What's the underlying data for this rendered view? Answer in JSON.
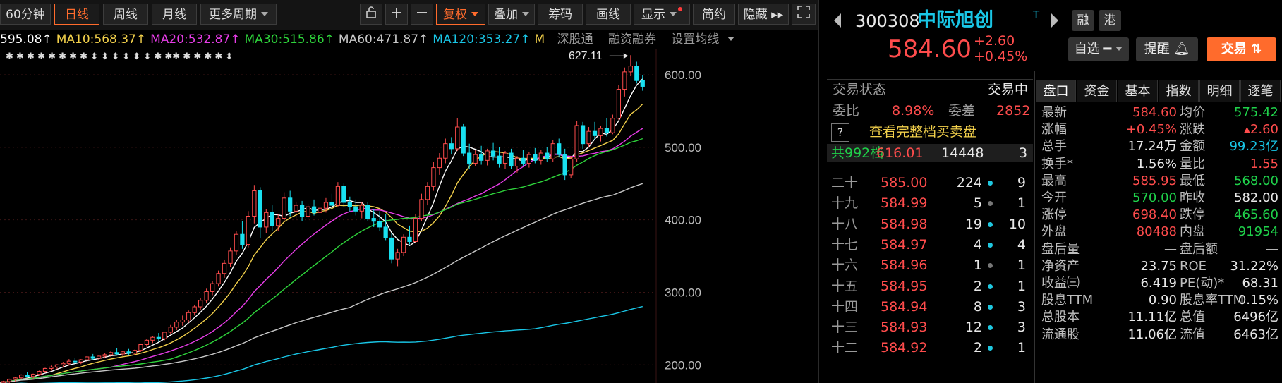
{
  "toolbar": {
    "left_buttons": [
      {
        "label": "60分钟",
        "selected": false
      },
      {
        "label": "日线",
        "selected": true
      },
      {
        "label": "周线",
        "selected": false
      },
      {
        "label": "月线",
        "selected": false
      },
      {
        "label": "更多周期",
        "selected": false,
        "dropdown": true
      }
    ],
    "right_buttons": [
      {
        "label": "复权",
        "dropdown": true,
        "active": true
      },
      {
        "label": "叠加",
        "dropdown": true
      },
      {
        "label": "筹码"
      },
      {
        "label": "画线"
      },
      {
        "label": "显示",
        "dropdown": true,
        "badge": true
      },
      {
        "label": "简约"
      },
      {
        "label": "隐藏 ▸▸"
      }
    ],
    "icons": [
      "lock-icon",
      "plus-icon",
      "minus-icon",
      "fullscreen-icon"
    ]
  },
  "ma_legend": [
    {
      "text": "595.08↑",
      "color": "#ffffff"
    },
    {
      "text": "MA10:568.37↑",
      "color": "#f2d04b"
    },
    {
      "text": "MA20:532.87↑",
      "color": "#e83de8"
    },
    {
      "text": "MA30:515.86↑",
      "color": "#2ed33b"
    },
    {
      "text": "MA60:471.87↑",
      "color": "#c8c8c8"
    },
    {
      "text": "MA120:353.27↑",
      "color": "#19c6e6"
    },
    {
      "text": "M",
      "color": "#f2d04b"
    }
  ],
  "legend_links": [
    "深股通",
    "融资融券",
    "设置均线"
  ],
  "chart_data": {
    "type": "candlestick",
    "ylim": [
      175,
      635
    ],
    "y_ticks": [
      "600.00",
      "500.00",
      "400.00",
      "300.00",
      "200.00"
    ],
    "y_tick_values": [
      600,
      500,
      400,
      300,
      200
    ],
    "annotation": {
      "label": "627.11"
    },
    "candles": [
      [
        172,
        176,
        170,
        175
      ],
      [
        175,
        178,
        172,
        177
      ],
      [
        177,
        181,
        175,
        180
      ],
      [
        180,
        183,
        177,
        182
      ],
      [
        182,
        187,
        180,
        186
      ],
      [
        186,
        190,
        183,
        184
      ],
      [
        184,
        188,
        181,
        187
      ],
      [
        187,
        192,
        185,
        191
      ],
      [
        191,
        196,
        189,
        195
      ],
      [
        195,
        199,
        192,
        197
      ],
      [
        197,
        201,
        194,
        200
      ],
      [
        200,
        204,
        197,
        202
      ],
      [
        202,
        208,
        199,
        205
      ],
      [
        205,
        209,
        201,
        204
      ],
      [
        204,
        208,
        201,
        207
      ],
      [
        207,
        212,
        204,
        211
      ],
      [
        211,
        215,
        207,
        209
      ],
      [
        209,
        213,
        206,
        212
      ],
      [
        212,
        216,
        209,
        214
      ],
      [
        214,
        219,
        211,
        217
      ],
      [
        217,
        223,
        214,
        215
      ],
      [
        215,
        219,
        212,
        218
      ],
      [
        218,
        222,
        214,
        216
      ],
      [
        216,
        221,
        213,
        220
      ],
      [
        220,
        229,
        218,
        228
      ],
      [
        228,
        236,
        225,
        234
      ],
      [
        234,
        240,
        230,
        238
      ],
      [
        238,
        244,
        232,
        236
      ],
      [
        236,
        246,
        234,
        245
      ],
      [
        245,
        255,
        242,
        252
      ],
      [
        252,
        262,
        248,
        259
      ],
      [
        259,
        268,
        254,
        262
      ],
      [
        262,
        275,
        258,
        272
      ],
      [
        272,
        283,
        268,
        280
      ],
      [
        280,
        292,
        276,
        289
      ],
      [
        289,
        305,
        285,
        301
      ],
      [
        301,
        315,
        296,
        312
      ],
      [
        312,
        330,
        308,
        326
      ],
      [
        326,
        345,
        320,
        340
      ],
      [
        340,
        362,
        335,
        357
      ],
      [
        357,
        384,
        352,
        380
      ],
      [
        380,
        398,
        360,
        366
      ],
      [
        366,
        412,
        362,
        405
      ],
      [
        405,
        448,
        395,
        440
      ],
      [
        440,
        445,
        375,
        390
      ],
      [
        390,
        415,
        382,
        410
      ],
      [
        410,
        420,
        385,
        392
      ],
      [
        392,
        408,
        385,
        402
      ],
      [
        402,
        438,
        398,
        430
      ],
      [
        430,
        440,
        405,
        412
      ],
      [
        412,
        425,
        402,
        420
      ],
      [
        420,
        426,
        398,
        405
      ],
      [
        405,
        422,
        400,
        418
      ],
      [
        418,
        428,
        406,
        410
      ],
      [
        410,
        422,
        402,
        416
      ],
      [
        416,
        430,
        410,
        424
      ],
      [
        424,
        436,
        415,
        420
      ],
      [
        420,
        452,
        418,
        446
      ],
      [
        446,
        450,
        418,
        424
      ],
      [
        424,
        432,
        412,
        418
      ],
      [
        418,
        428,
        406,
        412
      ],
      [
        412,
        424,
        402,
        420
      ],
      [
        420,
        425,
        398,
        402
      ],
      [
        402,
        415,
        390,
        398
      ],
      [
        398,
        412,
        385,
        390
      ],
      [
        390,
        408,
        372,
        375
      ],
      [
        375,
        382,
        340,
        346
      ],
      [
        346,
        360,
        336,
        355
      ],
      [
        355,
        380,
        350,
        376
      ],
      [
        376,
        392,
        366,
        370
      ],
      [
        370,
        408,
        368,
        402
      ],
      [
        402,
        436,
        398,
        428
      ],
      [
        428,
        452,
        420,
        446
      ],
      [
        446,
        480,
        440,
        472
      ],
      [
        472,
        492,
        462,
        485
      ],
      [
        485,
        512,
        478,
        505
      ],
      [
        505,
        514,
        490,
        498
      ],
      [
        498,
        540,
        495,
        528
      ],
      [
        528,
        532,
        488,
        492
      ],
      [
        492,
        505,
        470,
        478
      ],
      [
        478,
        496,
        474,
        490
      ],
      [
        490,
        502,
        476,
        482
      ],
      [
        482,
        498,
        475,
        495
      ],
      [
        495,
        506,
        482,
        488
      ],
      [
        488,
        500,
        472,
        478
      ],
      [
        478,
        495,
        470,
        492
      ],
      [
        492,
        498,
        470,
        474
      ],
      [
        474,
        488,
        465,
        485
      ],
      [
        485,
        496,
        474,
        478
      ],
      [
        478,
        494,
        472,
        490
      ],
      [
        490,
        499,
        478,
        482
      ],
      [
        482,
        496,
        476,
        492
      ],
      [
        492,
        500,
        480,
        484
      ],
      [
        484,
        510,
        480,
        505
      ],
      [
        505,
        512,
        486,
        490
      ],
      [
        490,
        498,
        455,
        462
      ],
      [
        462,
        488,
        458,
        484
      ],
      [
        484,
        536,
        480,
        530
      ],
      [
        530,
        535,
        498,
        505
      ],
      [
        505,
        528,
        500,
        522
      ],
      [
        522,
        535,
        510,
        516
      ],
      [
        516,
        530,
        508,
        526
      ],
      [
        526,
        540,
        515,
        520
      ],
      [
        520,
        545,
        518,
        540
      ],
      [
        540,
        586,
        538,
        580
      ],
      [
        580,
        610,
        570,
        604
      ],
      [
        604,
        627,
        598,
        612
      ],
      [
        612,
        618,
        588,
        592
      ],
      [
        592,
        600,
        578,
        584
      ]
    ],
    "ma_series": [
      {
        "name": "MA5",
        "color": "#ffffff",
        "period": 5
      },
      {
        "name": "MA10",
        "color": "#f2d04b",
        "period": 10
      },
      {
        "name": "MA20",
        "color": "#e83de8",
        "period": 20
      },
      {
        "name": "MA30",
        "color": "#2ed33b",
        "period": 30
      },
      {
        "name": "MA60",
        "color": "#c8c8c8",
        "period": 60
      },
      {
        "name": "MA120",
        "color": "#19c6e6",
        "period": 120
      }
    ]
  },
  "stock": {
    "code": "300308",
    "name": "中际旭创",
    "tag": "T",
    "badges": [
      "融",
      "港"
    ],
    "price": "584.60",
    "change": "+2.60",
    "change_pct": "+0.45%",
    "buttons": {
      "watch": "自选",
      "alert": "提醒",
      "trade": "交易"
    }
  },
  "trade_status": {
    "label": "交易状态",
    "value": "交易中"
  },
  "order_ratio": {
    "label1": "委比",
    "value1": "8.98%",
    "label2": "委差",
    "value2": "2852"
  },
  "full_book_link": "查看完整档买卖盘",
  "total_levels": {
    "label": "共992档",
    "price": "616.01",
    "volume": "14448",
    "count": "3"
  },
  "order_levels": [
    {
      "label": "二十",
      "price": "585.00",
      "volume": "224",
      "dot": "cyan",
      "count": "9"
    },
    {
      "label": "十九",
      "price": "584.99",
      "volume": "5",
      "dot": "gray",
      "count": "1"
    },
    {
      "label": "十八",
      "price": "584.98",
      "volume": "19",
      "dot": "cyan",
      "count": "10"
    },
    {
      "label": "十七",
      "price": "584.97",
      "volume": "4",
      "dot": "cyan",
      "count": "4"
    },
    {
      "label": "十六",
      "price": "584.96",
      "volume": "1",
      "dot": "gray",
      "count": "1"
    },
    {
      "label": "十五",
      "price": "584.95",
      "volume": "2",
      "dot": "cyan",
      "count": "1"
    },
    {
      "label": "十四",
      "price": "584.94",
      "volume": "8",
      "dot": "cyan",
      "count": "3"
    },
    {
      "label": "十三",
      "price": "584.93",
      "volume": "12",
      "dot": "cyan",
      "count": "3"
    },
    {
      "label": "十二",
      "price": "584.92",
      "volume": "2",
      "dot": "cyan",
      "count": "1"
    }
  ],
  "tabs": [
    "盘口",
    "资金",
    "基本",
    "指数",
    "明细",
    "逐笔"
  ],
  "stats": [
    {
      "l1": "最新",
      "v1": "584.60",
      "c1": "red",
      "l2": "均价",
      "v2": "575.42",
      "c2": "green"
    },
    {
      "l1": "涨幅",
      "v1": "+0.45%",
      "c1": "red",
      "l2": "涨跌",
      "v2": "▴2.60",
      "c2": "red"
    },
    {
      "l1": "总手",
      "v1": "17.24万",
      "c1": "white",
      "l2": "金额",
      "v2": "99.23亿",
      "c2": "cyan"
    },
    {
      "l1": "换手*",
      "v1": "1.56%",
      "c1": "white",
      "l2": "量比",
      "v2": "1.55",
      "c2": "red"
    },
    {
      "l1": "最高",
      "v1": "585.95",
      "c1": "red",
      "l2": "最低",
      "v2": "568.00",
      "c2": "green"
    },
    {
      "l1": "今开",
      "v1": "570.00",
      "c1": "green",
      "l2": "昨收",
      "v2": "582.00",
      "c2": "white"
    },
    {
      "l1": "涨停",
      "v1": "698.40",
      "c1": "red",
      "l2": "跌停",
      "v2": "465.60",
      "c2": "green"
    },
    {
      "l1": "外盘",
      "v1": "80488",
      "c1": "red",
      "l2": "内盘",
      "v2": "91954",
      "c2": "green"
    },
    {
      "l1": "盘后量",
      "v1": "—",
      "c1": "white",
      "l2": "盘后额",
      "v2": "—",
      "c2": "white"
    },
    {
      "l1": "净资产",
      "v1": "23.75",
      "c1": "white",
      "l2": "ROE",
      "v2": "31.22%",
      "c2": "white"
    },
    {
      "l1": "收益㈢",
      "v1": "6.419",
      "c1": "white",
      "l2": "PE(动)*",
      "v2": "68.31",
      "c2": "white"
    },
    {
      "l1": "股息TTM",
      "v1": "0.90",
      "c1": "white",
      "l2": "股息率TTM",
      "v2": "0.15%",
      "c2": "white"
    },
    {
      "l1": "总股本",
      "v1": "11.11亿",
      "c1": "white",
      "l2": "总值",
      "v2": "6496亿",
      "c2": "white"
    },
    {
      "l1": "流通股",
      "v1": "11.06亿",
      "c1": "white",
      "l2": "流值",
      "v2": "6463亿",
      "c2": "white"
    }
  ],
  "colors": {
    "up": "#ff4c4c",
    "down": "#19e0f0",
    "accent": "#ff6b2c"
  }
}
